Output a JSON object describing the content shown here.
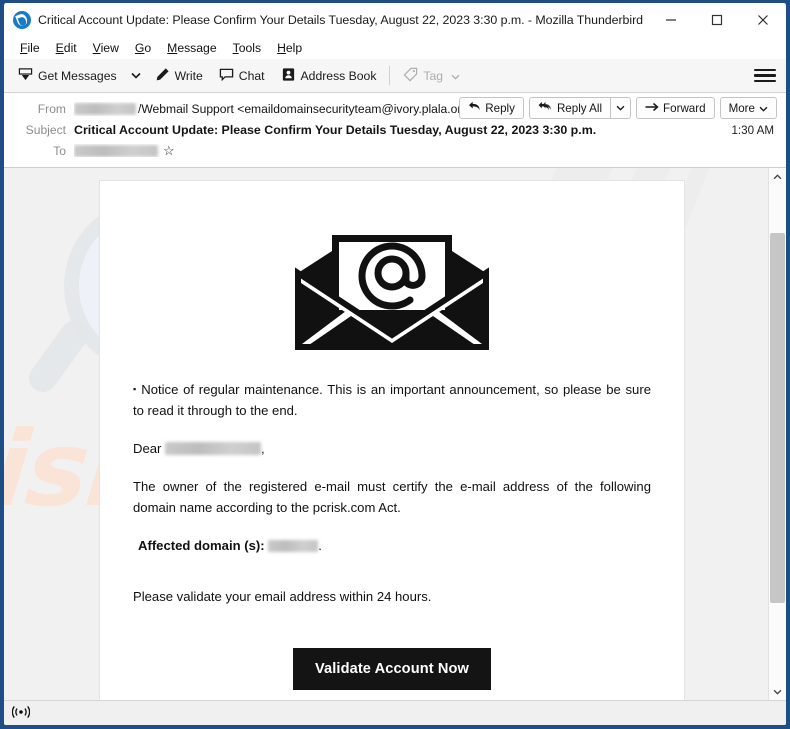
{
  "window": {
    "title": "Critical Account Update: Please Confirm Your Details Tuesday, August 22, 2023 3:30 p.m. - Mozilla Thunderbird",
    "app_icon": "thunderbird-icon",
    "controls": {
      "minimize": "minimize-icon",
      "maximize": "maximize-icon",
      "close": "close-icon"
    }
  },
  "menubar": {
    "items": [
      {
        "label": "File",
        "accesskey": "F"
      },
      {
        "label": "Edit",
        "accesskey": "E"
      },
      {
        "label": "View",
        "accesskey": "V"
      },
      {
        "label": "Go",
        "accesskey": "G"
      },
      {
        "label": "Message",
        "accesskey": "M"
      },
      {
        "label": "Tools",
        "accesskey": "T"
      },
      {
        "label": "Help",
        "accesskey": "H"
      }
    ]
  },
  "toolbar": {
    "get_messages": "Get Messages",
    "write": "Write",
    "chat": "Chat",
    "address_book": "Address Book",
    "tag": "Tag",
    "tag_disabled": true,
    "app_menu": "hamburger-icon"
  },
  "message_header": {
    "from_label": "From",
    "from_redacted": true,
    "from_value": "/Webmail Support <emaildomainsecurityteam@ivory.plala.or.jp>",
    "subject_label": "Subject",
    "subject_value": "Critical Account Update: Please Confirm Your Details Tuesday, August 22, 2023 3:30 p.m.",
    "to_label": "To",
    "to_redacted": true,
    "timestamp": "1:30 AM",
    "star_icon": "star-icon",
    "actions": {
      "reply": "Reply",
      "reply_all": "Reply All",
      "reply_all_caret": "chevron-down-icon",
      "forward": "Forward",
      "more": "More",
      "more_caret": "chevron-down-icon"
    }
  },
  "email_body": {
    "logo_alt": "envelope-at-symbol-icon",
    "bullet": "▪",
    "paragraph_1": "Notice of regular maintenance. This is an important announcement, so please be sure to read it through to the end.",
    "greeting_prefix": "Dear",
    "greeting_redacted": true,
    "greeting_suffix": ",",
    "paragraph_2": "The owner of the registered e-mail must certify the e-mail address of the following domain name according to the pcrisk.com Act.",
    "affected_label": "Affected domain (s):",
    "affected_redacted": true,
    "affected_suffix": ".",
    "paragraph_3": "Please validate your email address within 24 hours.",
    "cta_button": "Validate Account Now"
  },
  "watermark": {
    "text": "risk.com",
    "logo": "magnifying-glass-icon",
    "color": "#fbe3d6"
  },
  "scrollbar": {
    "up_arrow": "chevron-up-icon",
    "down_arrow": "chevron-down-icon"
  },
  "statusbar": {
    "connection_icon": "wireless-signal-icon"
  },
  "colors": {
    "window_frame": "#1f4e87",
    "toolbar_bg": "#f6f6f6",
    "body_bg": "#f1f1f1",
    "cta_bg": "#141414"
  }
}
